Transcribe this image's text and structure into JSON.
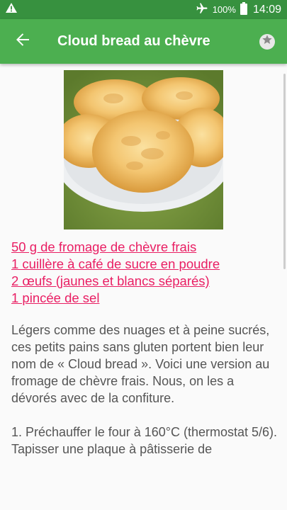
{
  "status_bar": {
    "battery_percent": "100%",
    "time": "14:09",
    "icons": [
      "warning-icon",
      "airplane-icon",
      "battery-icon"
    ]
  },
  "app_bar": {
    "title": "Cloud bread au chèvre",
    "icons": [
      "back-arrow-icon",
      "star-icon"
    ]
  },
  "recipe": {
    "ingredients": [
      "50 g de fromage de chèvre frais",
      "1 cuillère à café de sucre en poudre",
      "2 œufs (jaunes et blancs séparés)",
      "1 pincée de sel"
    ],
    "description": "Légers comme des nuages et à peine sucrés, ces petits pains sans gluten portent bien leur nom de « Cloud bread ». Voici une version au fromage de chèvre frais. Nous, on les a dévorés avec de la confiture.",
    "step_1": "1. Préchauffer le four à 160°C (thermostat 5/6). Tapisser une plaque à pâtisserie de"
  },
  "colors": {
    "status_bar": "#37913f",
    "app_bar": "#4caf50",
    "ingredient_link": "#e91e63",
    "body_text": "#555555"
  }
}
